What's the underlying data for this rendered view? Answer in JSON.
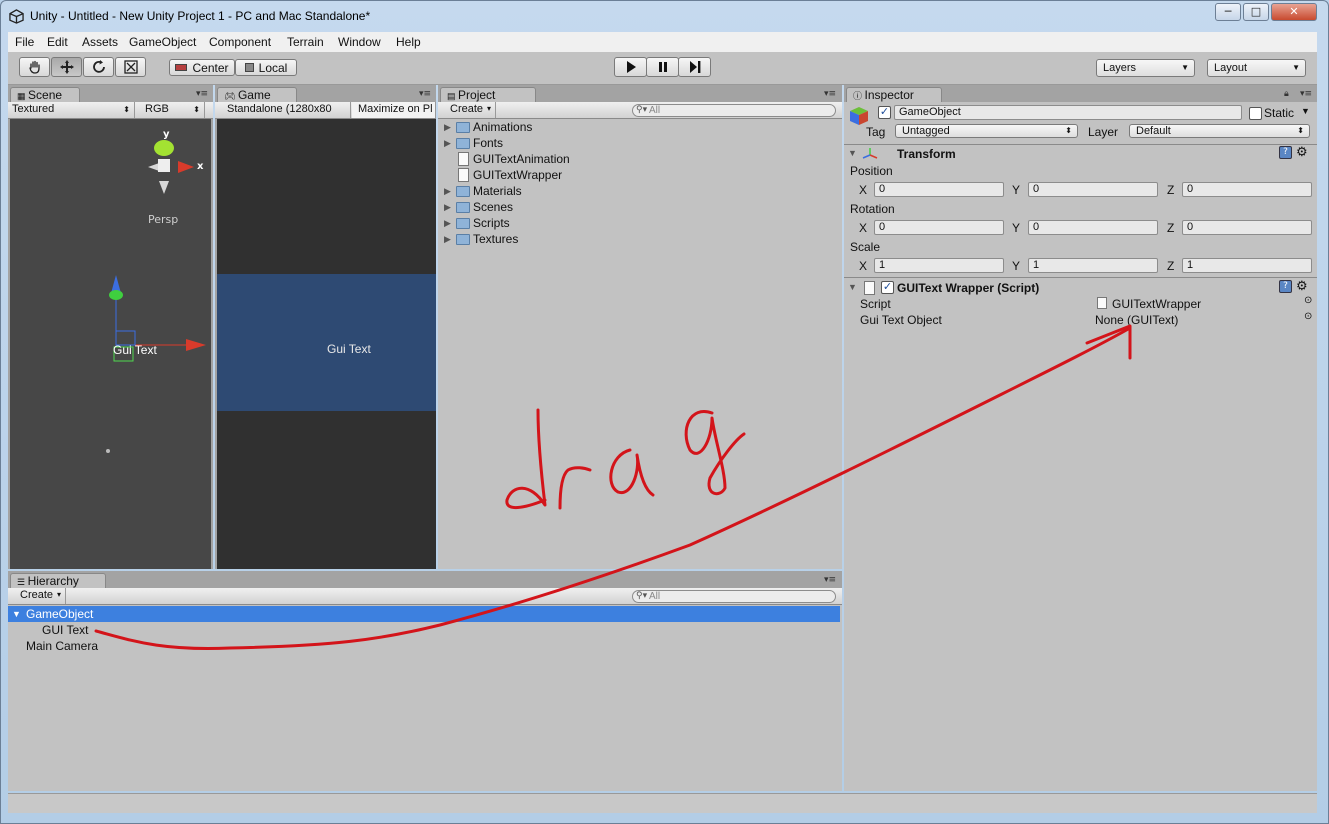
{
  "window": {
    "title": "Unity - Untitled - New Unity Project 1 - PC and Mac Standalone*",
    "minimize": "─",
    "maximize": "□",
    "close": "✕"
  },
  "menu": [
    "File",
    "Edit",
    "Assets",
    "GameObject",
    "Component",
    "Terrain",
    "Window",
    "Help"
  ],
  "toolbar": {
    "pivot_label": "Center",
    "space_label": "Local",
    "layers_label": "Layers",
    "layout_label": "Layout"
  },
  "scene": {
    "tab": "Scene",
    "render_mode": "Textured",
    "channel": "RGB",
    "gizmo_y": "y",
    "gizmo_x": "x",
    "persp_label": "Persp",
    "object_label": "Gui Text"
  },
  "game": {
    "tab": "Game",
    "resolution": "Standalone (1280x80",
    "maximize": "Maximize on Pl",
    "text": "Gui Text"
  },
  "project": {
    "tab": "Project",
    "create": "Create",
    "search_placeholder": "All",
    "items": [
      {
        "name": "Animations",
        "type": "folder"
      },
      {
        "name": "Fonts",
        "type": "folder"
      },
      {
        "name": "GUITextAnimation",
        "type": "script"
      },
      {
        "name": "GUITextWrapper",
        "type": "script"
      },
      {
        "name": "Materials",
        "type": "folder"
      },
      {
        "name": "Scenes",
        "type": "folder"
      },
      {
        "name": "Scripts",
        "type": "folder"
      },
      {
        "name": "Textures",
        "type": "folder"
      }
    ]
  },
  "hierarchy": {
    "tab": "Hierarchy",
    "create": "Create",
    "search_placeholder": "All",
    "rows": [
      "GameObject",
      "GUI Text",
      "Main Camera"
    ]
  },
  "inspector": {
    "tab": "Inspector",
    "object_name": "GameObject",
    "static_label": "Static",
    "tag_label": "Tag",
    "tag_value": "Untagged",
    "layer_label": "Layer",
    "layer_value": "Default",
    "transform_title": "Transform",
    "position_label": "Position",
    "rotation_label": "Rotation",
    "scale_label": "Scale",
    "axis_x": "X",
    "axis_y": "Y",
    "axis_z": "Z",
    "position": [
      "0",
      "0",
      "0"
    ],
    "rotation": [
      "0",
      "0",
      "0"
    ],
    "scale": [
      "1",
      "1",
      "1"
    ],
    "script_component_title": "GUIText Wrapper (Script)",
    "script_label": "Script",
    "script_value": "GUITextWrapper",
    "gui_text_object_label": "Gui Text Object",
    "gui_text_object_value": "None (GUIText)"
  },
  "annotation": {
    "text": "drag",
    "color": "#d3141a"
  },
  "colors": {
    "selection": "#3d80df",
    "game_band": "#2e4a73",
    "scene_bg": "#474747"
  }
}
